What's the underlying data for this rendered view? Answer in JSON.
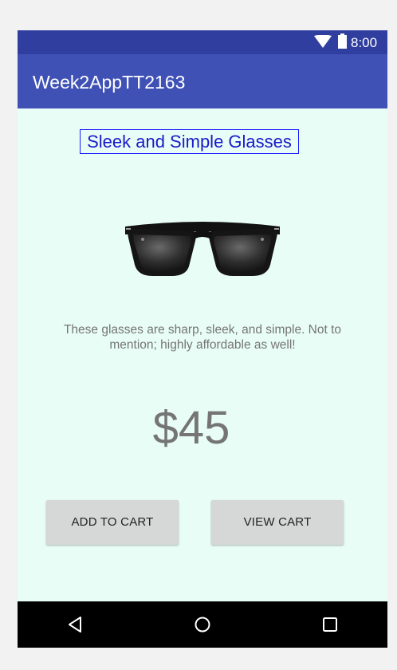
{
  "status_bar": {
    "time": "8:00",
    "icons": [
      "wifi-icon",
      "battery-icon"
    ]
  },
  "app_bar": {
    "title": "Week2AppTT2163"
  },
  "product": {
    "title": "Sleek and Simple Glasses",
    "image": "sunglasses",
    "description": "These glasses are sharp, sleek, and simple. Not to mention; highly affordable as well!",
    "price": "$45"
  },
  "buttons": {
    "add_to_cart": "ADD TO CART",
    "view_cart": "VIEW CART"
  },
  "nav_bar": {
    "icons": [
      "back-icon",
      "home-icon",
      "recent-apps-icon"
    ]
  },
  "colors": {
    "status_bar": "#303f9f",
    "app_bar": "#3f51b5",
    "content_bg": "#e8fdf5",
    "title_text": "#1a1acc",
    "button_bg": "#d6d7d7"
  }
}
